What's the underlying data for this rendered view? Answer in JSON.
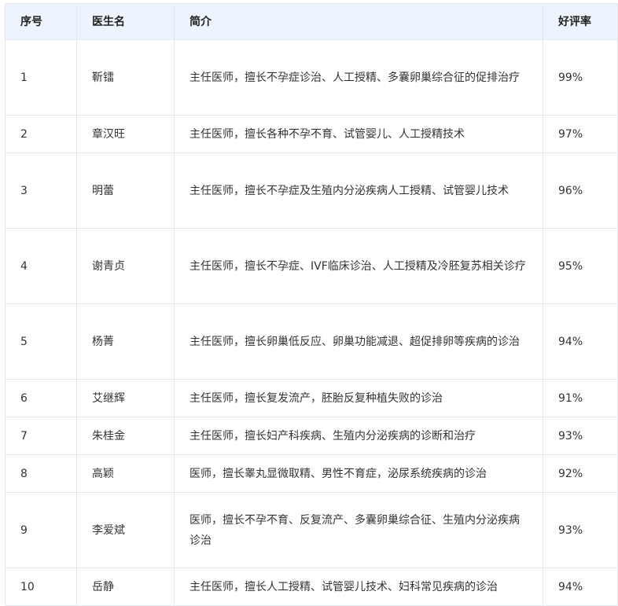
{
  "table": {
    "headers": [
      "序号",
      "医生名",
      "简介",
      "好评率"
    ],
    "rows": [
      {
        "no": "1",
        "name": "靳镭",
        "intro": "主任医师，擅长不孕症诊治、人工授精、多囊卵巢综合征的促排治疗",
        "rate": "99%"
      },
      {
        "no": "2",
        "name": "章汉旺",
        "intro": "主任医师，擅长各种不孕不育、试管婴儿、人工授精技术",
        "rate": "97%"
      },
      {
        "no": "3",
        "name": "明蕾",
        "intro": "主任医师，擅长不孕症及生殖内分泌疾病人工授精、试管婴儿技术",
        "rate": "96%"
      },
      {
        "no": "4",
        "name": "谢青贞",
        "intro": "主任医师，擅长不孕症、IVF临床诊治、人工授精及冷胚复苏相关诊疗",
        "rate": "95%"
      },
      {
        "no": "5",
        "name": "杨菁",
        "intro": "主任医师，擅长卵巢低反应、卵巢功能减退、超促排卵等疾病的诊治",
        "rate": "94%"
      },
      {
        "no": "6",
        "name": "艾继辉",
        "intro": "主任医师，擅长复发流产，胚胎反复种植失败的诊治",
        "rate": "91%"
      },
      {
        "no": "7",
        "name": "朱桂金",
        "intro": "主任医师，擅长妇产科疾病、生殖内分泌疾病的诊断和治疗",
        "rate": "93%"
      },
      {
        "no": "8",
        "name": "高颖",
        "intro": "医师，擅长睾丸显微取精、男性不育症，泌尿系统疾病的诊治",
        "rate": "92%"
      },
      {
        "no": "9",
        "name": "李爱斌",
        "intro": "医师，擅长不孕不育、反复流产、多囊卵巢综合征、生殖内分泌疾病诊治",
        "rate": "93%"
      },
      {
        "no": "10",
        "name": "岳静",
        "intro": "主任医师，擅长人工授精、试管婴儿技术、妇科常见疾病的诊治",
        "rate": "94%"
      }
    ]
  },
  "colors": {
    "header_bg": "#eef4fd",
    "border": "#e3e6ea",
    "text": "#333333"
  }
}
